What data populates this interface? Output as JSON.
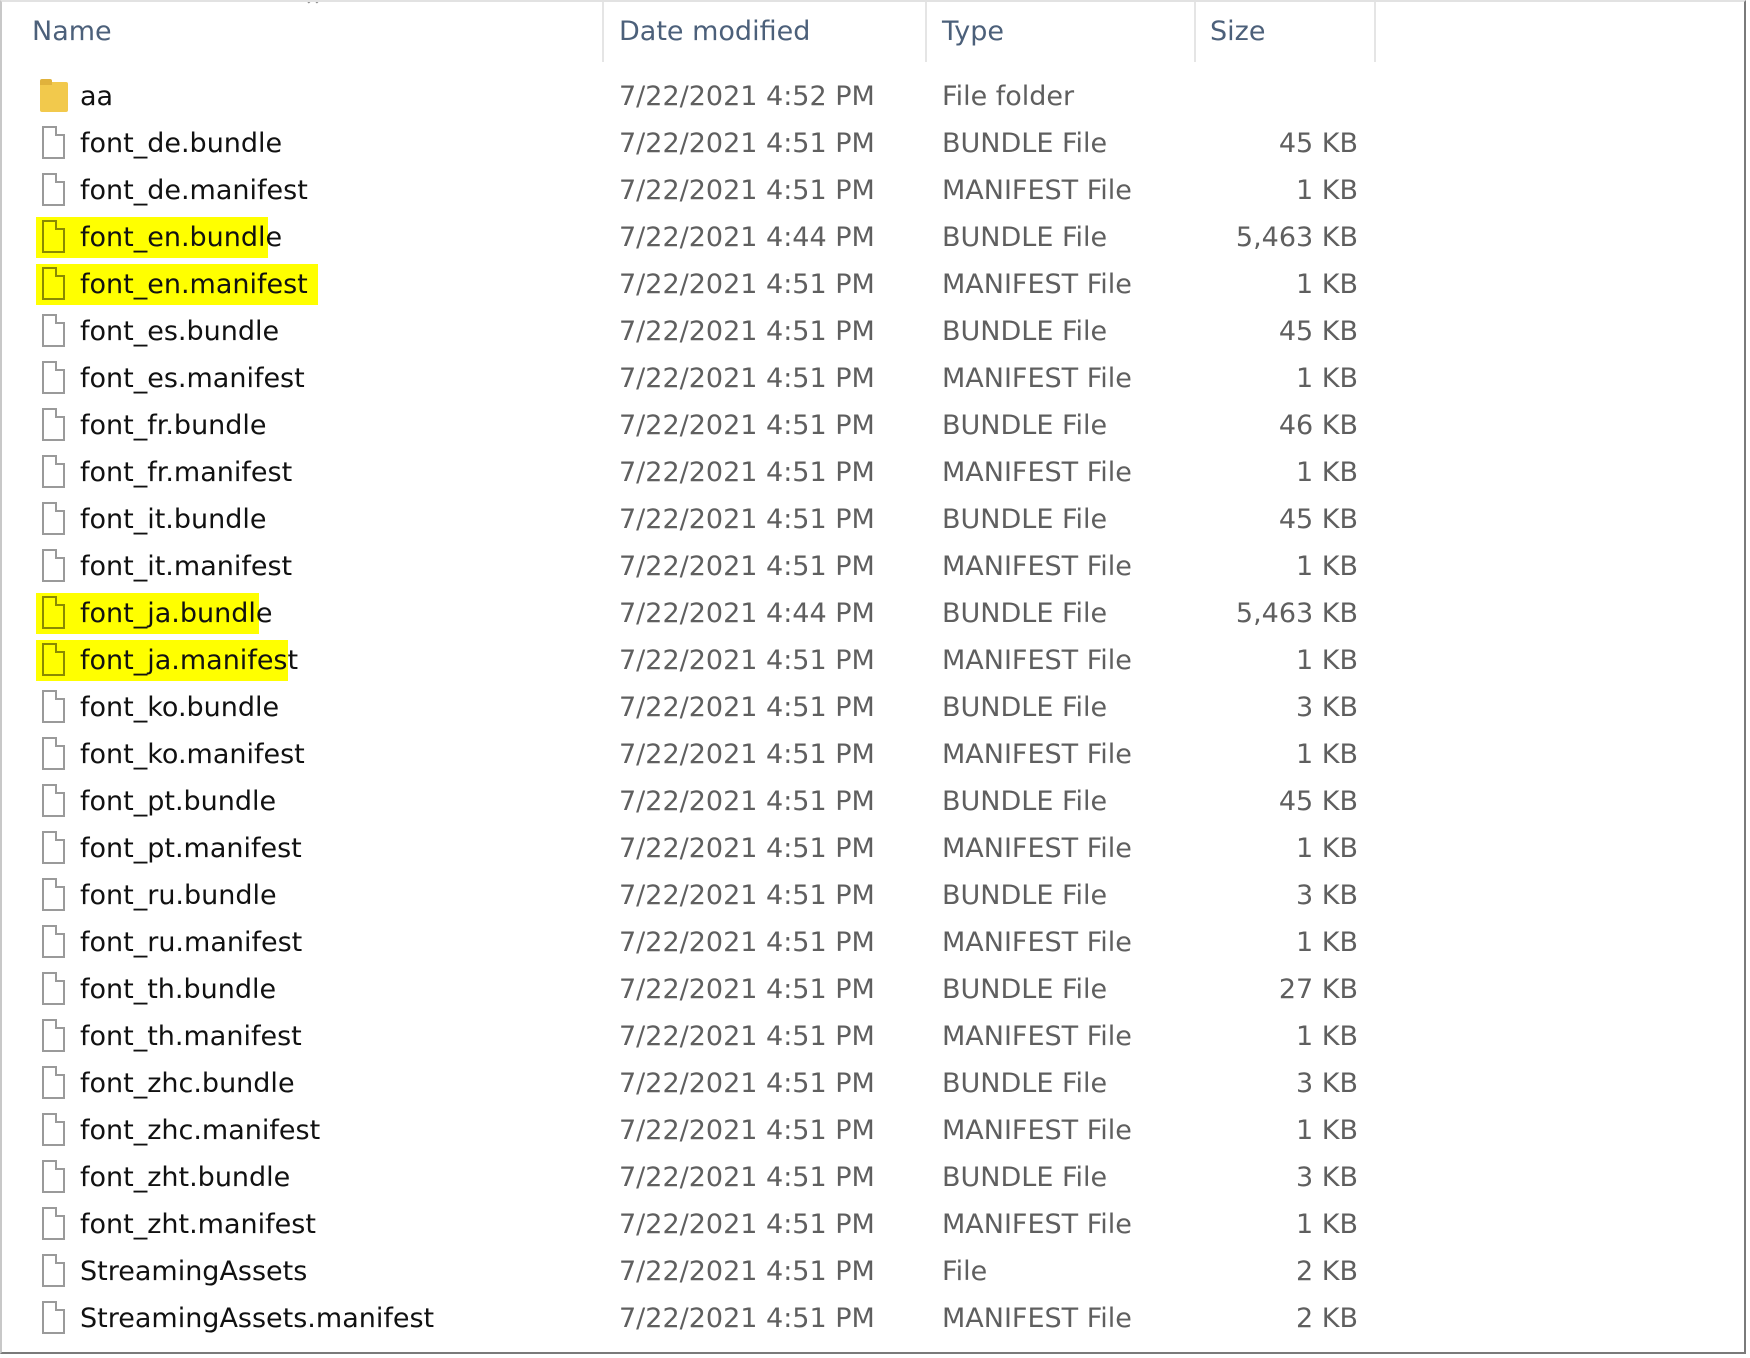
{
  "columns": {
    "name": "Name",
    "date": "Date modified",
    "type": "Type",
    "size": "Size"
  },
  "icons": {
    "sort": "sort-ascending-caret-icon",
    "file": "file-icon",
    "folder": "folder-icon"
  },
  "highlight_color": "#ffff00",
  "files": [
    {
      "name": "aa",
      "date": "7/22/2021 4:52 PM",
      "type": "File folder",
      "size": "",
      "kind": "folder",
      "highlighted": false
    },
    {
      "name": "font_de.bundle",
      "date": "7/22/2021 4:51 PM",
      "type": "BUNDLE File",
      "size": "45 KB",
      "kind": "file",
      "highlighted": false
    },
    {
      "name": "font_de.manifest",
      "date": "7/22/2021 4:51 PM",
      "type": "MANIFEST File",
      "size": "1 KB",
      "kind": "file",
      "highlighted": false
    },
    {
      "name": "font_en.bundle",
      "date": "7/22/2021 4:44 PM",
      "type": "BUNDLE File",
      "size": "5,463 KB",
      "kind": "file",
      "highlighted": true
    },
    {
      "name": "font_en.manifest",
      "date": "7/22/2021 4:51 PM",
      "type": "MANIFEST File",
      "size": "1 KB",
      "kind": "file",
      "highlighted": true
    },
    {
      "name": "font_es.bundle",
      "date": "7/22/2021 4:51 PM",
      "type": "BUNDLE File",
      "size": "45 KB",
      "kind": "file",
      "highlighted": false
    },
    {
      "name": "font_es.manifest",
      "date": "7/22/2021 4:51 PM",
      "type": "MANIFEST File",
      "size": "1 KB",
      "kind": "file",
      "highlighted": false
    },
    {
      "name": "font_fr.bundle",
      "date": "7/22/2021 4:51 PM",
      "type": "BUNDLE File",
      "size": "46 KB",
      "kind": "file",
      "highlighted": false
    },
    {
      "name": "font_fr.manifest",
      "date": "7/22/2021 4:51 PM",
      "type": "MANIFEST File",
      "size": "1 KB",
      "kind": "file",
      "highlighted": false
    },
    {
      "name": "font_it.bundle",
      "date": "7/22/2021 4:51 PM",
      "type": "BUNDLE File",
      "size": "45 KB",
      "kind": "file",
      "highlighted": false
    },
    {
      "name": "font_it.manifest",
      "date": "7/22/2021 4:51 PM",
      "type": "MANIFEST File",
      "size": "1 KB",
      "kind": "file",
      "highlighted": false
    },
    {
      "name": "font_ja.bundle",
      "date": "7/22/2021 4:44 PM",
      "type": "BUNDLE File",
      "size": "5,463 KB",
      "kind": "file",
      "highlighted": true
    },
    {
      "name": "font_ja.manifest",
      "date": "7/22/2021 4:51 PM",
      "type": "MANIFEST File",
      "size": "1 KB",
      "kind": "file",
      "highlighted": true
    },
    {
      "name": "font_ko.bundle",
      "date": "7/22/2021 4:51 PM",
      "type": "BUNDLE File",
      "size": "3 KB",
      "kind": "file",
      "highlighted": false
    },
    {
      "name": "font_ko.manifest",
      "date": "7/22/2021 4:51 PM",
      "type": "MANIFEST File",
      "size": "1 KB",
      "kind": "file",
      "highlighted": false
    },
    {
      "name": "font_pt.bundle",
      "date": "7/22/2021 4:51 PM",
      "type": "BUNDLE File",
      "size": "45 KB",
      "kind": "file",
      "highlighted": false
    },
    {
      "name": "font_pt.manifest",
      "date": "7/22/2021 4:51 PM",
      "type": "MANIFEST File",
      "size": "1 KB",
      "kind": "file",
      "highlighted": false
    },
    {
      "name": "font_ru.bundle",
      "date": "7/22/2021 4:51 PM",
      "type": "BUNDLE File",
      "size": "3 KB",
      "kind": "file",
      "highlighted": false
    },
    {
      "name": "font_ru.manifest",
      "date": "7/22/2021 4:51 PM",
      "type": "MANIFEST File",
      "size": "1 KB",
      "kind": "file",
      "highlighted": false
    },
    {
      "name": "font_th.bundle",
      "date": "7/22/2021 4:51 PM",
      "type": "BUNDLE File",
      "size": "27 KB",
      "kind": "file",
      "highlighted": false
    },
    {
      "name": "font_th.manifest",
      "date": "7/22/2021 4:51 PM",
      "type": "MANIFEST File",
      "size": "1 KB",
      "kind": "file",
      "highlighted": false
    },
    {
      "name": "font_zhc.bundle",
      "date": "7/22/2021 4:51 PM",
      "type": "BUNDLE File",
      "size": "3 KB",
      "kind": "file",
      "highlighted": false
    },
    {
      "name": "font_zhc.manifest",
      "date": "7/22/2021 4:51 PM",
      "type": "MANIFEST File",
      "size": "1 KB",
      "kind": "file",
      "highlighted": false
    },
    {
      "name": "font_zht.bundle",
      "date": "7/22/2021 4:51 PM",
      "type": "BUNDLE File",
      "size": "3 KB",
      "kind": "file",
      "highlighted": false
    },
    {
      "name": "font_zht.manifest",
      "date": "7/22/2021 4:51 PM",
      "type": "MANIFEST File",
      "size": "1 KB",
      "kind": "file",
      "highlighted": false
    },
    {
      "name": "StreamingAssets",
      "date": "7/22/2021 4:51 PM",
      "type": "File",
      "size": "2 KB",
      "kind": "file",
      "highlighted": false
    },
    {
      "name": "StreamingAssets.manifest",
      "date": "7/22/2021 4:51 PM",
      "type": "MANIFEST File",
      "size": "2 KB",
      "kind": "file",
      "highlighted": false
    }
  ]
}
